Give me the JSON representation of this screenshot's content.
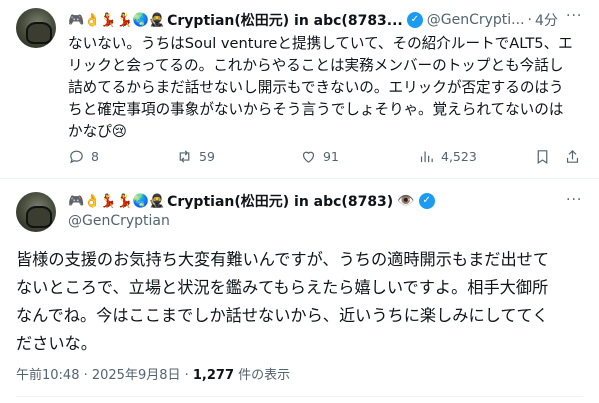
{
  "tweet1": {
    "emojis": "🎮👌💃💃🌏🥷",
    "display_name": "Cryptian(松田元) in abc(8783...",
    "handle": "@GenCrypti...",
    "separator": "·",
    "time": "4分",
    "more": "···",
    "lines": [
      "ないない。うちはSoul ventureと提携していて、その紹介ルートでALT5、エ",
      "リックと会ってるの。これからやることは実務メンバーのトップとも今話し",
      "詰めてるからまだ話せないし開示もできないの。エリックが否定するのはう",
      "ちと確定事項の事象がないからそう言うでしょそりゃ。覚えられてないのは",
      "かなぴ😢"
    ],
    "actions": {
      "replies": "8",
      "reposts": "59",
      "likes": "91",
      "views": "4,523"
    }
  },
  "tweet2": {
    "emojis": "🎮👌💃💃🌏🥷",
    "display_name": "Cryptian(松田元) in abc(8783)",
    "eye_emoji": "👁️",
    "handle": "@GenCryptian",
    "more": "···",
    "lines": [
      "皆様の支援のお気持ち大変有難いんですが、うちの適時開示もまだ出せて",
      "ないところで、立場と状況を鑑みてもらえたら嬉しいですよ。相手大御所",
      "なんでね。今はここまでしか話せないから、近いうちに楽しみにしててく",
      "ださいな。"
    ],
    "timestamp": "午前10:48 · 2025年9月8日 · ",
    "view_count": "1,277",
    "view_suffix": " 件の表示"
  },
  "colors": {
    "accent": "#1d9bf0",
    "secondary_text": "#536471",
    "primary_text": "#0f1419"
  },
  "icons": [
    "reply-icon",
    "repost-icon",
    "like-icon",
    "views-icon",
    "bookmark-icon",
    "share-icon",
    "verified-badge-icon",
    "more-icon"
  ]
}
